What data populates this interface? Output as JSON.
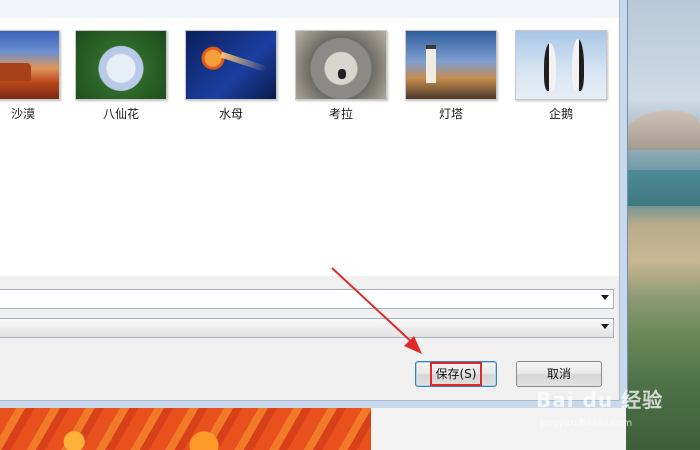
{
  "thumbnails": [
    {
      "label": "沙漠",
      "icon": "desert-image"
    },
    {
      "label": "八仙花",
      "icon": "hydrangea-image"
    },
    {
      "label": "水母",
      "icon": "jellyfish-image"
    },
    {
      "label": "考拉",
      "icon": "koala-image"
    },
    {
      "label": "灯塔",
      "icon": "lighthouse-image"
    },
    {
      "label": "企鹅",
      "icon": "penguins-image"
    }
  ],
  "form": {
    "filename_value": "",
    "savetype_value": ""
  },
  "buttons": {
    "save_label": "保存(S)",
    "cancel_label": "取消"
  },
  "watermark": {
    "brand": "Bai du 经验",
    "url": "jingyan.baidu.com"
  },
  "colors": {
    "highlight": "#e02a2a",
    "arrow": "#e02a2a"
  }
}
